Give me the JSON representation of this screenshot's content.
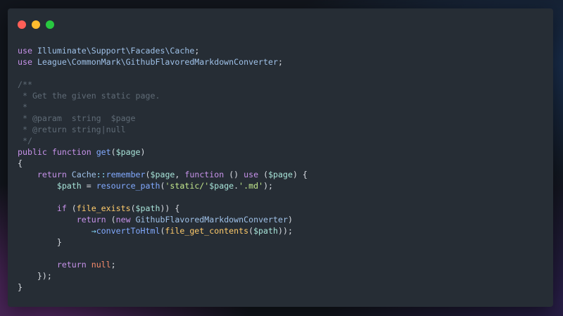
{
  "window": {
    "controls": [
      {
        "name": "close",
        "color": "#ff5f57"
      },
      {
        "name": "minimize",
        "color": "#febc2e"
      },
      {
        "name": "zoom",
        "color": "#28c840"
      }
    ]
  },
  "code": {
    "lines": [
      [
        [
          "kw",
          "use"
        ],
        [
          "pl",
          " "
        ],
        [
          "ns",
          "Illuminate\\Support\\Facades\\Cache"
        ],
        [
          "pl",
          ";"
        ]
      ],
      [
        [
          "kw",
          "use"
        ],
        [
          "pl",
          " "
        ],
        [
          "ns",
          "League\\CommonMark\\GithubFlavoredMarkdownConverter"
        ],
        [
          "pl",
          ";"
        ]
      ],
      [],
      [
        [
          "cm",
          "/**"
        ]
      ],
      [
        [
          "cm",
          " * Get the given static page."
        ]
      ],
      [
        [
          "cm",
          " *"
        ]
      ],
      [
        [
          "cm",
          " * @param  string  $page"
        ]
      ],
      [
        [
          "cm",
          " * @return string|null"
        ]
      ],
      [
        [
          "cm",
          " */"
        ]
      ],
      [
        [
          "kw",
          "public"
        ],
        [
          "pl",
          " "
        ],
        [
          "kw",
          "function"
        ],
        [
          "pl",
          " "
        ],
        [
          "fn",
          "get"
        ],
        [
          "pl",
          "("
        ],
        [
          "var",
          "$page"
        ],
        [
          "pl",
          ")"
        ]
      ],
      [
        [
          "pl",
          "{"
        ]
      ],
      [
        [
          "pl",
          "    "
        ],
        [
          "kw",
          "return"
        ],
        [
          "pl",
          " "
        ],
        [
          "ns",
          "Cache"
        ],
        [
          "op",
          "::"
        ],
        [
          "fn",
          "remember"
        ],
        [
          "pl",
          "("
        ],
        [
          "var",
          "$page"
        ],
        [
          "pl",
          ", "
        ],
        [
          "kw",
          "function"
        ],
        [
          "pl",
          " () "
        ],
        [
          "kw",
          "use"
        ],
        [
          "pl",
          " ("
        ],
        [
          "var",
          "$page"
        ],
        [
          "pl",
          ") {"
        ]
      ],
      [
        [
          "pl",
          "        "
        ],
        [
          "var",
          "$path"
        ],
        [
          "pl",
          " = "
        ],
        [
          "fn",
          "resource_path"
        ],
        [
          "pl",
          "("
        ],
        [
          "str",
          "'static/'"
        ],
        [
          "var",
          "$page"
        ],
        [
          "pl",
          "."
        ],
        [
          "str",
          "'.md'"
        ],
        [
          "pl",
          ");"
        ]
      ],
      [],
      [
        [
          "pl",
          "        "
        ],
        [
          "kw",
          "if"
        ],
        [
          "pl",
          " ("
        ],
        [
          "builtin",
          "file_exists"
        ],
        [
          "pl",
          "("
        ],
        [
          "var",
          "$path"
        ],
        [
          "pl",
          ")) {"
        ]
      ],
      [
        [
          "pl",
          "            "
        ],
        [
          "kw",
          "return"
        ],
        [
          "pl",
          " ("
        ],
        [
          "kw",
          "new"
        ],
        [
          "pl",
          " "
        ],
        [
          "ns",
          "GithubFlavoredMarkdownConverter"
        ],
        [
          "pl",
          ")"
        ]
      ],
      [
        [
          "pl",
          "               "
        ],
        [
          "op",
          "→"
        ],
        [
          "fn",
          "convertToHtml"
        ],
        [
          "pl",
          "("
        ],
        [
          "builtin",
          "file_get_contents"
        ],
        [
          "pl",
          "("
        ],
        [
          "var",
          "$path"
        ],
        [
          "pl",
          "));"
        ]
      ],
      [
        [
          "pl",
          "        }"
        ]
      ],
      [],
      [
        [
          "pl",
          "        "
        ],
        [
          "kw",
          "return"
        ],
        [
          "pl",
          " "
        ],
        [
          "null",
          "null"
        ],
        [
          "pl",
          ";"
        ]
      ],
      [
        [
          "pl",
          "    });"
        ]
      ],
      [
        [
          "pl",
          "}"
        ]
      ]
    ]
  }
}
